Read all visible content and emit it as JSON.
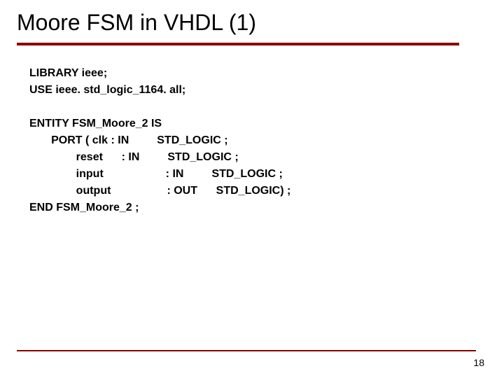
{
  "title": "Moore FSM in VHDL (1)",
  "code": {
    "line1": "LIBRARY ieee;",
    "line2": "USE ieee. std_logic_1164. all;",
    "line3": "",
    "line4": "ENTITY FSM_Moore_2 IS",
    "line5": "       PORT ( clk : IN         STD_LOGIC ;",
    "line6": "               reset      : IN         STD_LOGIC ;",
    "line7": "               input                    : IN         STD_LOGIC ;",
    "line8": "               output                  : OUT      STD_LOGIC) ;",
    "line9": "END FSM_Moore_2 ;"
  },
  "pageNumber": "18"
}
